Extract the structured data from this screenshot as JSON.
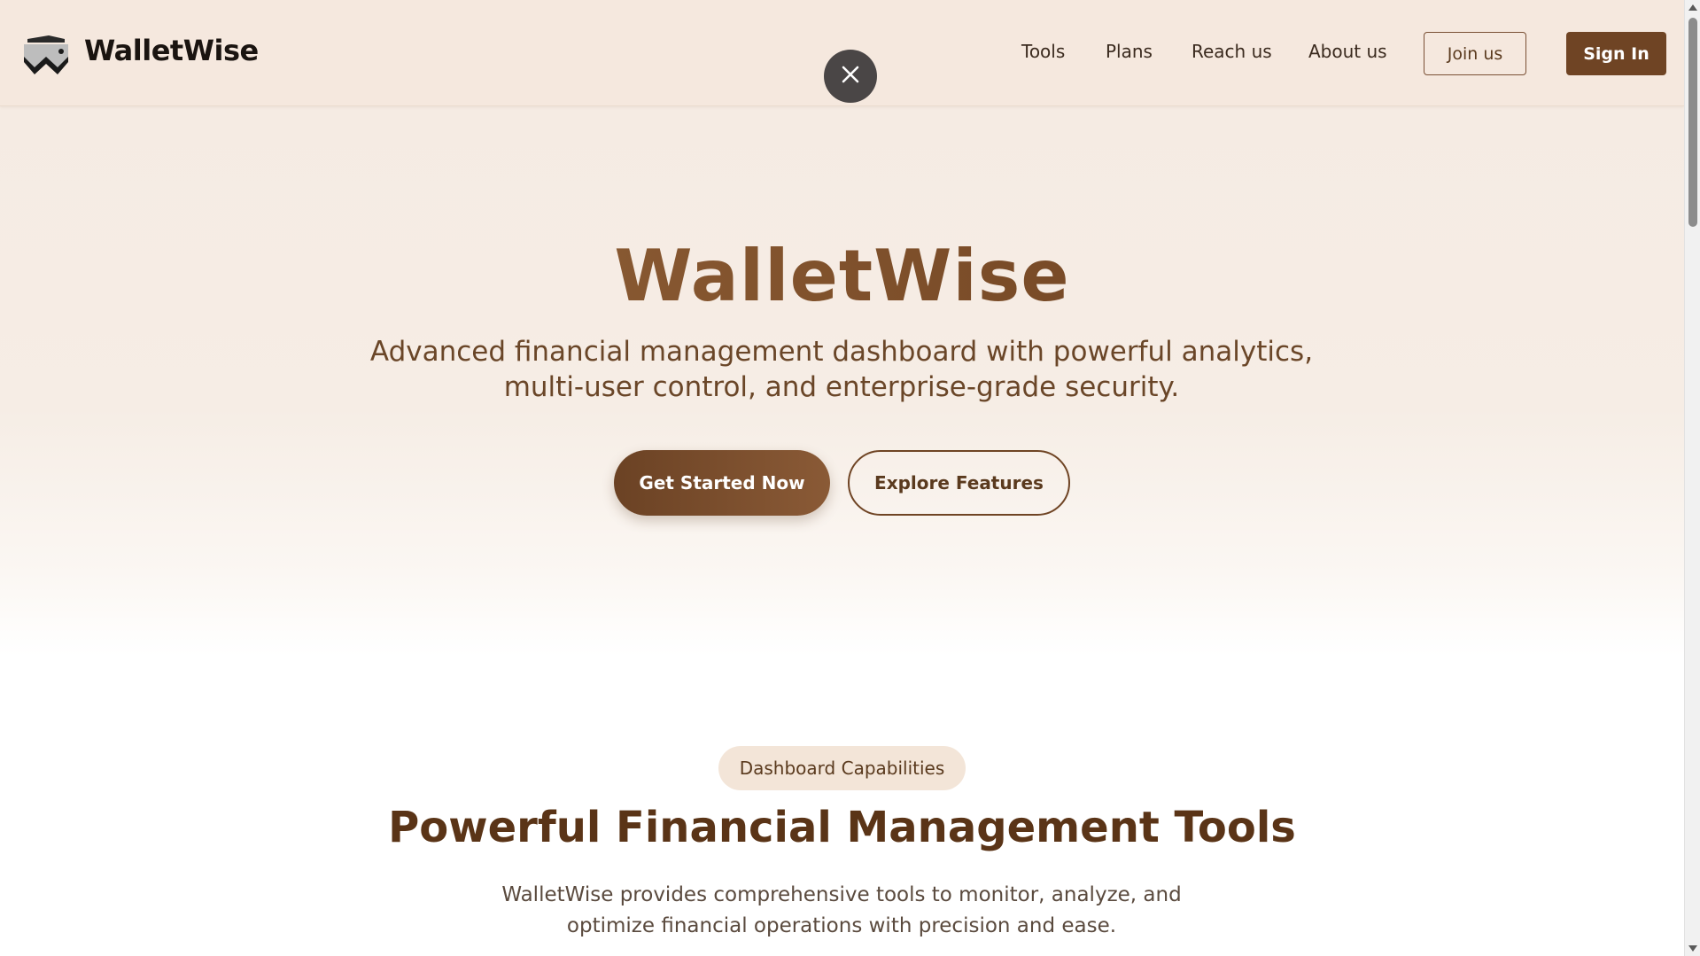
{
  "header": {
    "brand": "WalletWise",
    "nav": [
      "Tools",
      "Plans",
      "Reach us",
      "About us"
    ],
    "join_label": "Join us",
    "signin_label": "Sign In"
  },
  "hero": {
    "title": "WalletWise",
    "subtitle_line1": "Advanced financial management dashboard with powerful analytics,",
    "subtitle_line2": "multi-user control, and enterprise-grade security.",
    "primary_cta": "Get Started Now",
    "secondary_cta": "Explore Features"
  },
  "capabilities": {
    "badge": "Dashboard Capabilities",
    "title": "Powerful Financial Management Tools",
    "description_line1": "WalletWise provides comprehensive tools to monitor, analyze, and",
    "description_line2": "optimize financial operations with precision and ease."
  },
  "icons": {
    "logo": "walletwise-logo-icon",
    "close": "close-icon"
  },
  "colors": {
    "brand_brown": "#6f4424",
    "header_bg": "#f5e8de",
    "hero_bg": "#f5ebe3",
    "close_bg": "#4a4646"
  }
}
